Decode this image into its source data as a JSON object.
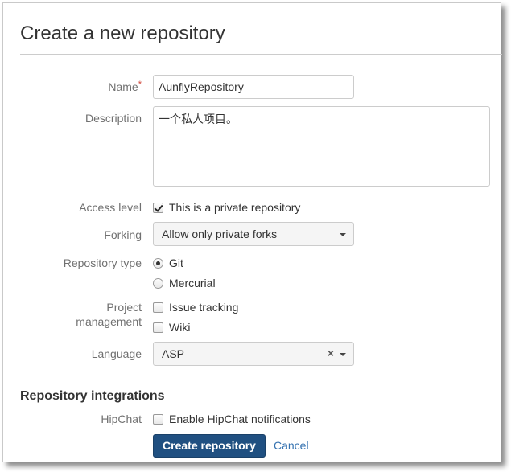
{
  "page": {
    "title": "Create a new repository"
  },
  "form": {
    "name": {
      "label": "Name",
      "required_mark": "*",
      "value": "AunflyRepository"
    },
    "description": {
      "label": "Description",
      "value": "一个私人项目。"
    },
    "access_level": {
      "label": "Access level",
      "option": "This is a private repository",
      "checked": true
    },
    "forking": {
      "label": "Forking",
      "selected": "Allow only private forks"
    },
    "repository_type": {
      "label": "Repository type",
      "options": [
        "Git",
        "Mercurial"
      ],
      "selected": "Git"
    },
    "project_management": {
      "label_line1": "Project",
      "label_line2": "management",
      "options": [
        "Issue tracking",
        "Wiki"
      ]
    },
    "language": {
      "label": "Language",
      "selected": "ASP",
      "clear": "×"
    }
  },
  "integrations": {
    "heading": "Repository integrations",
    "hipchat": {
      "label": "HipChat",
      "option": "Enable HipChat notifications",
      "checked": false
    }
  },
  "actions": {
    "create_label": "Create repository",
    "cancel_label": "Cancel"
  },
  "colors": {
    "primary_button": "#205081",
    "link": "#3572b0",
    "required": "#d04437"
  }
}
